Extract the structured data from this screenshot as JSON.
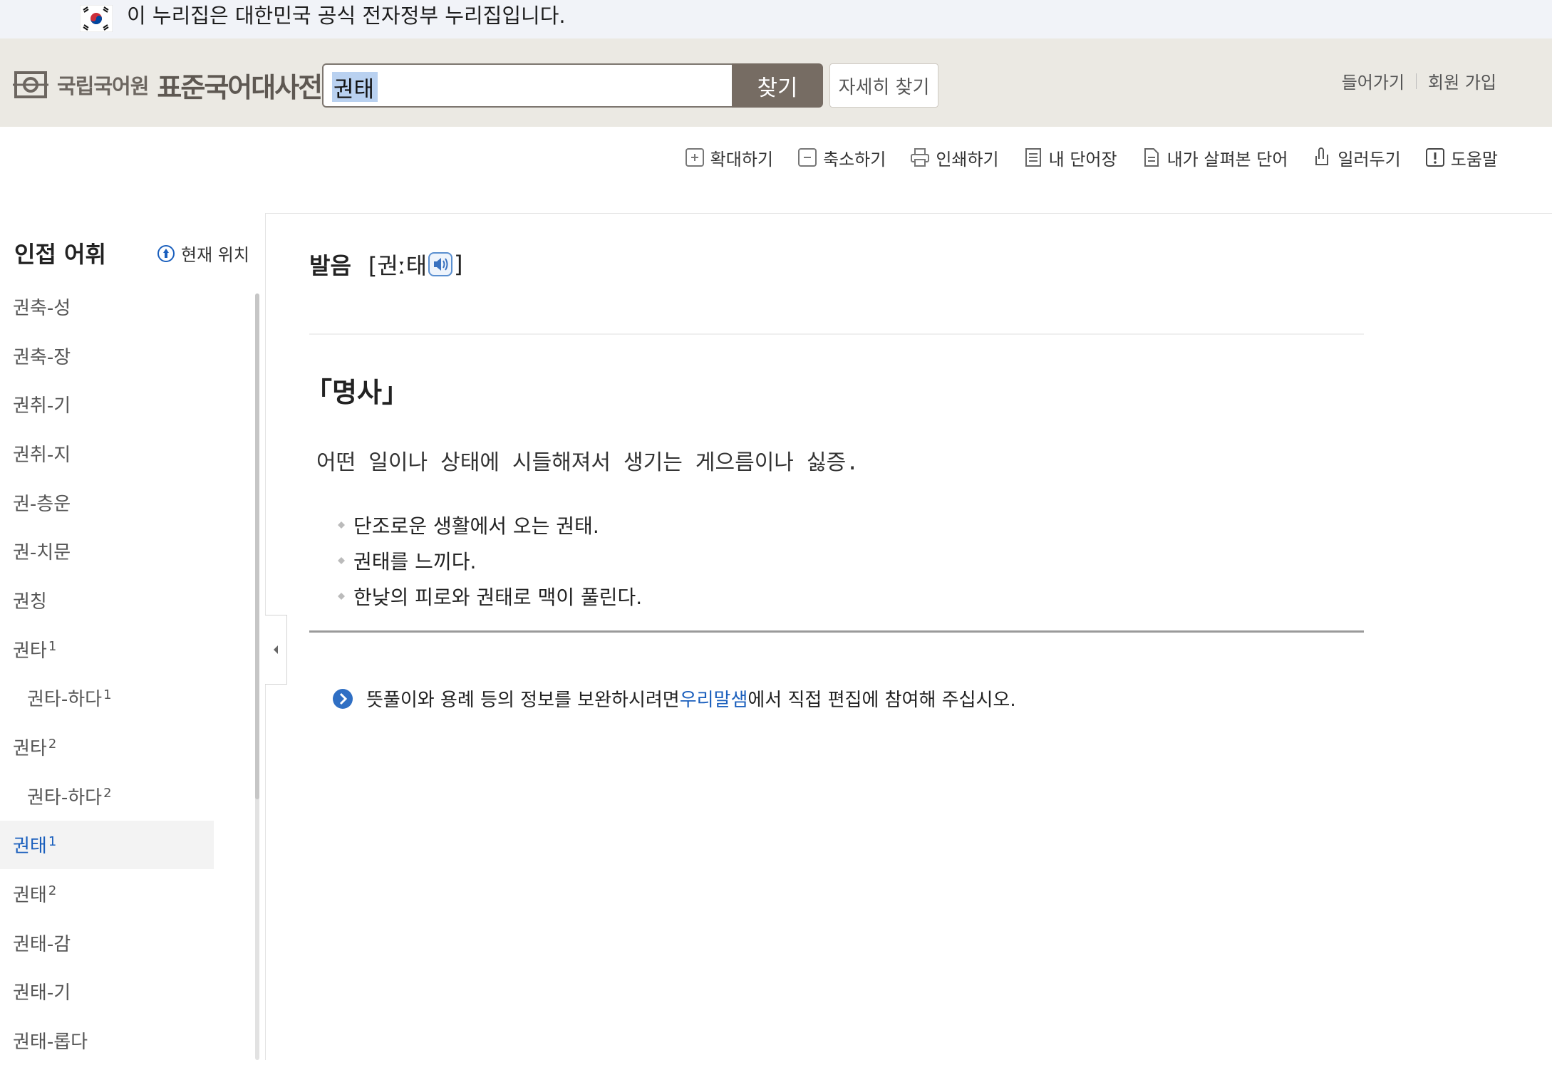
{
  "gov_banner": {
    "text": "이 누리집은 대한민국 공식 전자정부 누리집입니다."
  },
  "header": {
    "logo_org": "국립국어원",
    "logo_title": "표준국어대사전",
    "search_value": "권태",
    "search_button": "찾기",
    "detail_search": "자세히 찾기",
    "login": "들어가기",
    "signup": "회원 가입"
  },
  "toolbar": {
    "zoom_in": "확대하기",
    "zoom_out": "축소하기",
    "print": "인쇄하기",
    "my_words": "내 단어장",
    "viewed_words": "내가 살펴본 단어",
    "notify": "일러두기",
    "help": "도움말"
  },
  "sidebar": {
    "title": "인접 어휘",
    "current_location": "현재 위치",
    "words": [
      {
        "text": "권축-성",
        "sup": ""
      },
      {
        "text": "권축-장",
        "sup": ""
      },
      {
        "text": "권취-기",
        "sup": ""
      },
      {
        "text": "권취-지",
        "sup": ""
      },
      {
        "text": "권-층운",
        "sup": ""
      },
      {
        "text": "권-치문",
        "sup": ""
      },
      {
        "text": "권칭",
        "sup": ""
      },
      {
        "text": "권타",
        "sup": "1"
      },
      {
        "text": "권타-하다",
        "sup": "1"
      },
      {
        "text": "권타",
        "sup": "2"
      },
      {
        "text": "권타-하다",
        "sup": "2"
      },
      {
        "text": "권태",
        "sup": "1"
      },
      {
        "text": "권태",
        "sup": "2"
      },
      {
        "text": "권태-감",
        "sup": ""
      },
      {
        "text": "권태-기",
        "sup": ""
      },
      {
        "text": "권태-롭다",
        "sup": ""
      }
    ]
  },
  "entry": {
    "pron_label": "발음",
    "pron_open": "[권ː태",
    "pron_close": "]",
    "pos": "「명사」",
    "definition": "어떤 일이나 상태에 시들해져서 생기는 게으름이나 싫증.",
    "examples": [
      "단조로운 생활에서 오는 권태.",
      "권태를 느끼다.",
      "한낮의 피로와 권태로 맥이 풀린다."
    ],
    "notice_before": "뜻풀이와 용례 등의 정보를 보완하시려면 ",
    "notice_link": "우리말샘",
    "notice_after": "에서 직접 편집에 참여해 주십시오."
  }
}
